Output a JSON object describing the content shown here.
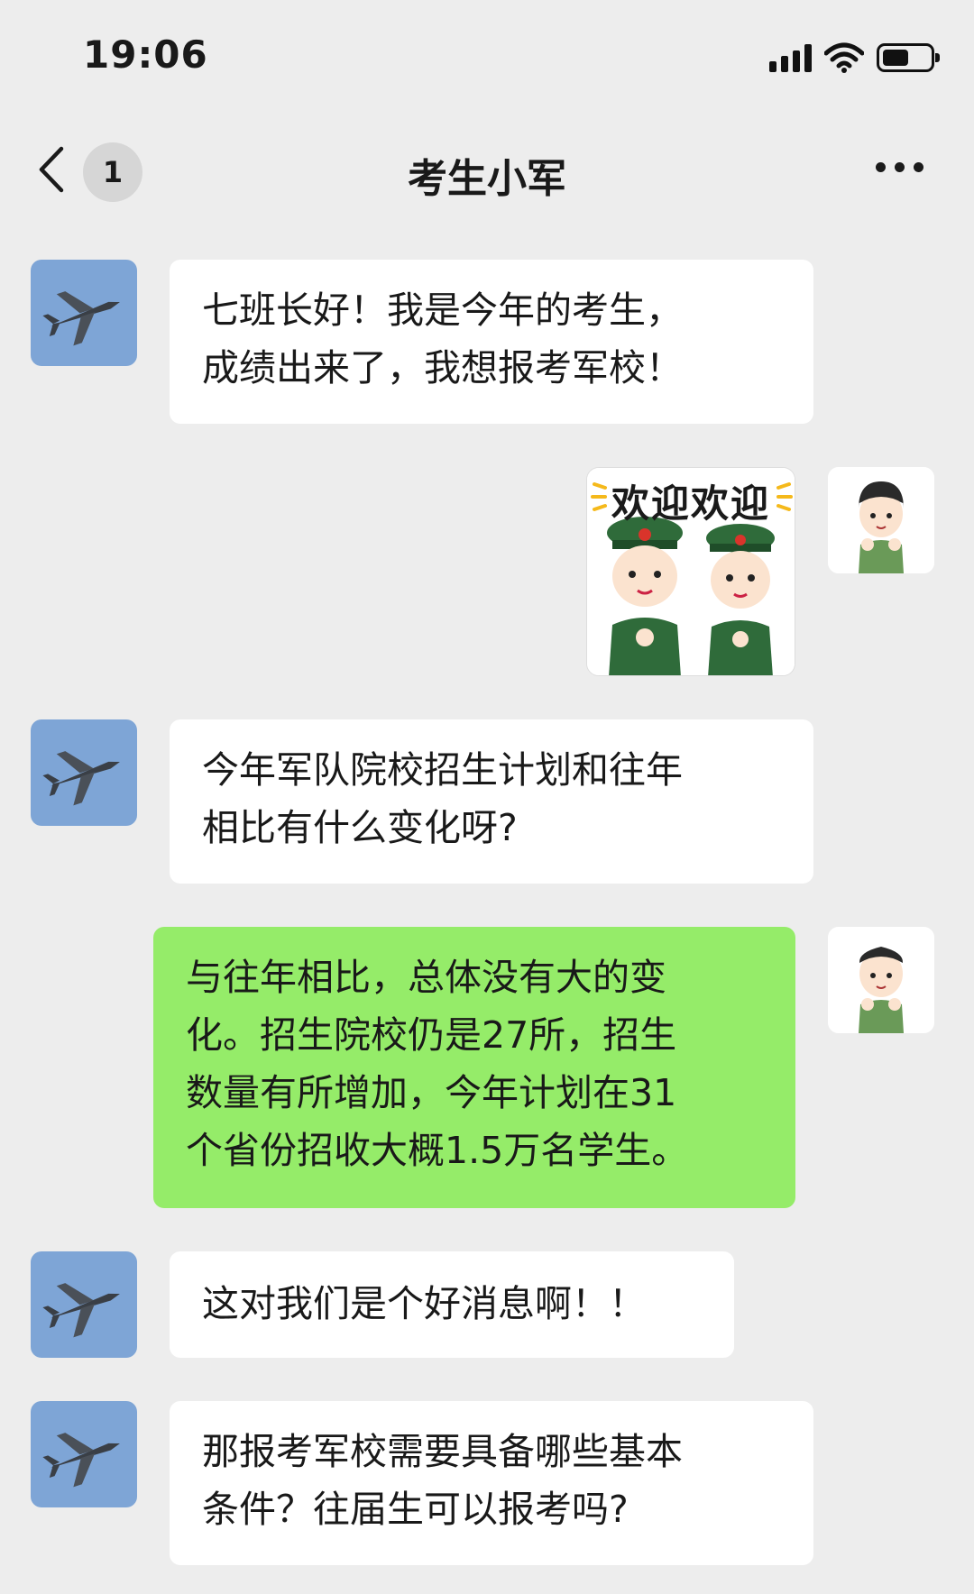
{
  "status_bar": {
    "time": "19:06",
    "icons": [
      "signal-icon",
      "wifi-icon",
      "battery-icon"
    ]
  },
  "nav": {
    "back_icon": "chevron-left-icon",
    "unread_count": "1",
    "title": "考生小军",
    "more_icon": "more-dots-icon"
  },
  "colors": {
    "background": "#ededed",
    "incoming_bubble": "#ffffff",
    "outgoing_bubble": "#95ec69"
  },
  "messages": [
    {
      "side": "left",
      "avatar": "fighter-jet-avatar",
      "text": "七班长好！我是今年的考生，\n成绩出来了，我想报考军校！"
    },
    {
      "side": "right",
      "avatar": "soldier-avatar",
      "sticker": {
        "text": "欢迎欢迎"
      }
    },
    {
      "side": "left",
      "avatar": "fighter-jet-avatar",
      "text": "今年军队院校招生计划和往年\n相比有什么变化呀?"
    },
    {
      "side": "right",
      "avatar": "soldier-avatar",
      "text": "与往年相比，总体没有大的变\n化。招生院校仍是27所，招生\n数量有所增加，今年计划在31\n个省份招收大概1.5万名学生。"
    },
    {
      "side": "left",
      "avatar": "fighter-jet-avatar",
      "text": "这对我们是个好消息啊！！"
    },
    {
      "side": "left",
      "avatar": "fighter-jet-avatar",
      "text": "那报考军校需要具备哪些基本\n条件？往届生可以报考吗?"
    }
  ]
}
